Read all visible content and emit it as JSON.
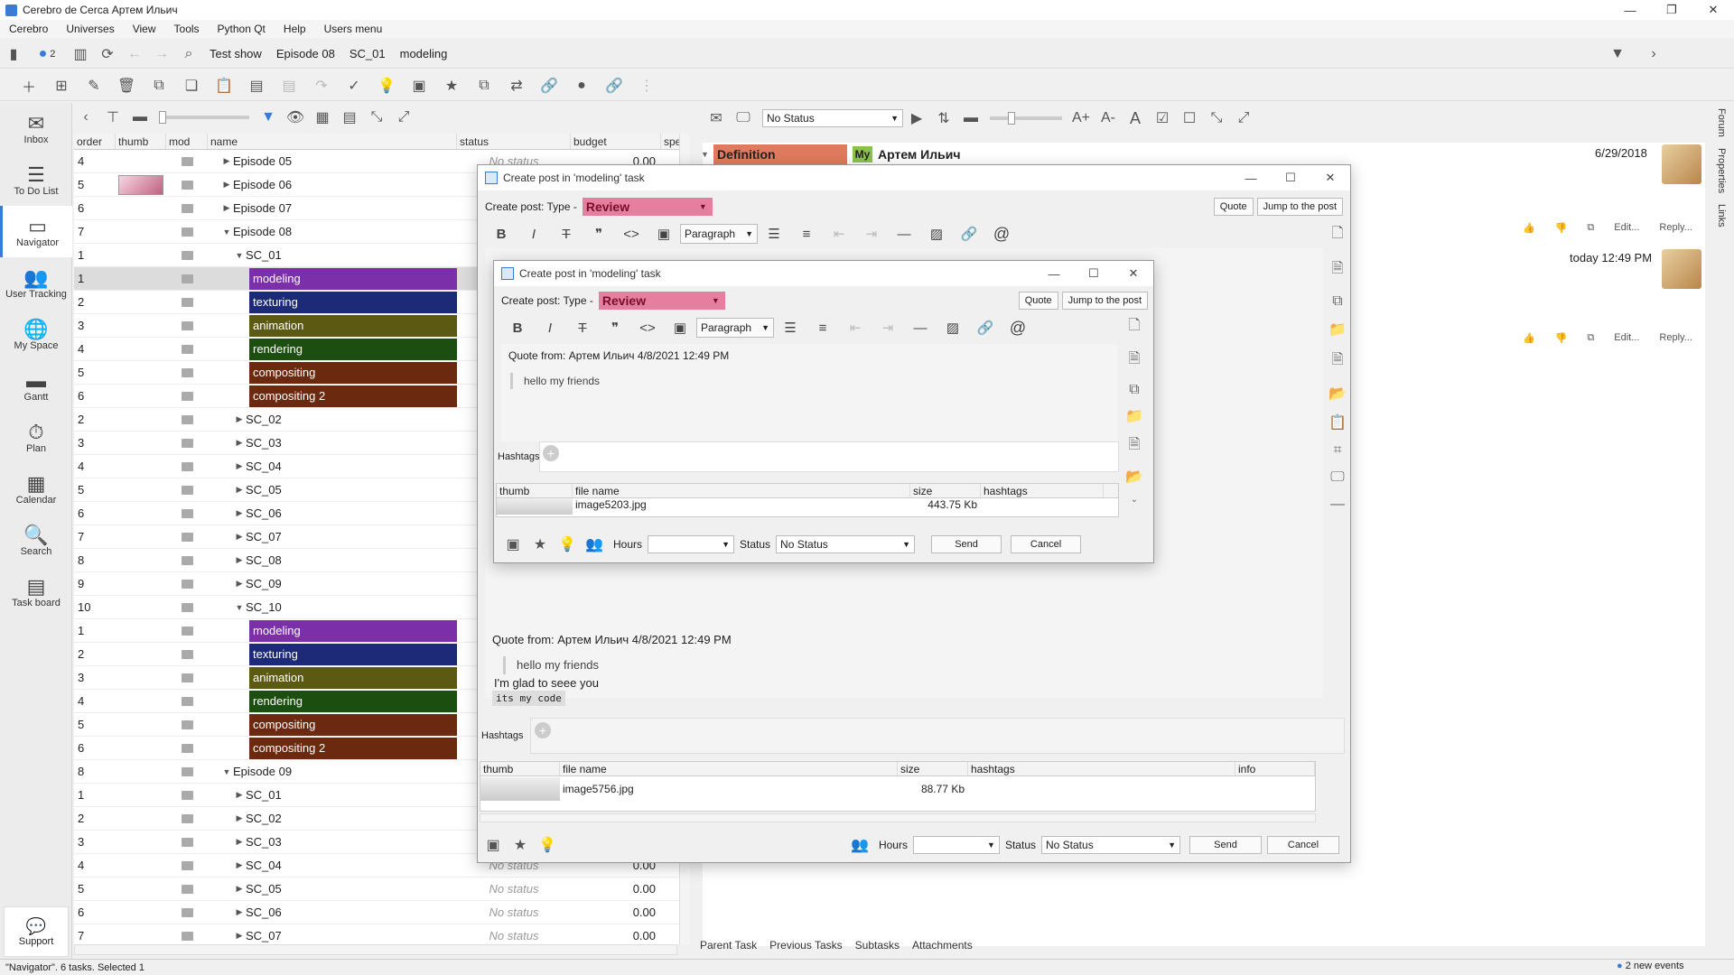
{
  "window": {
    "title": "Cerebro de Cerca  Артем Ильич"
  },
  "menu": [
    "Cerebro",
    "Universes",
    "View",
    "Tools",
    "Python Qt",
    "Help",
    "Users menu"
  ],
  "nav": {
    "badge": "2",
    "crumbs": [
      "Test show",
      "Episode 08",
      "SC_01",
      "modeling"
    ]
  },
  "sidebar": [
    {
      "label": "Inbox",
      "icon": "✉"
    },
    {
      "label": "To Do List",
      "icon": "☰"
    },
    {
      "label": "Navigator",
      "icon": "▭"
    },
    {
      "label": "User Tracking",
      "icon": "👥"
    },
    {
      "label": "My Space",
      "icon": "🌐"
    },
    {
      "label": "Gantt",
      "icon": "▬"
    },
    {
      "label": "Plan",
      "icon": "⏱"
    },
    {
      "label": "Calendar",
      "icon": "▦"
    },
    {
      "label": "Search",
      "icon": "🔍"
    },
    {
      "label": "Task board",
      "icon": "▤"
    }
  ],
  "support": "Support",
  "tree": {
    "columns": {
      "order": "order",
      "thumb": "thumb",
      "mod": "mod",
      "name": "name",
      "status": "status",
      "budget": "budget",
      "spe": "spe"
    },
    "rows": [
      {
        "order": "4",
        "name": "Episode 05",
        "lvl": 0,
        "exp": "closed",
        "status": "No status",
        "budget": "0.00"
      },
      {
        "order": "5",
        "name": "Episode 06",
        "lvl": 0,
        "exp": "closed",
        "thumb": true
      },
      {
        "order": "6",
        "name": "Episode 07",
        "lvl": 0,
        "exp": "closed"
      },
      {
        "order": "7",
        "name": "Episode 08",
        "lvl": 0,
        "exp": "open"
      },
      {
        "order": "1",
        "name": "SC_01",
        "lvl": 1,
        "exp": "open"
      },
      {
        "order": "1",
        "name": "modeling",
        "task": "#7b2fa8",
        "sel": true
      },
      {
        "order": "2",
        "name": "texturing",
        "task": "#1d2a78"
      },
      {
        "order": "3",
        "name": "animation",
        "task": "#5c5a12"
      },
      {
        "order": "4",
        "name": "rendering",
        "task": "#1c4e10"
      },
      {
        "order": "5",
        "name": "compositing",
        "task": "#6b2a10"
      },
      {
        "order": "6",
        "name": "compositing 2",
        "task": "#6b2a10"
      },
      {
        "order": "2",
        "name": "SC_02",
        "lvl": 1,
        "exp": "closed"
      },
      {
        "order": "3",
        "name": "SC_03",
        "lvl": 1,
        "exp": "closed"
      },
      {
        "order": "4",
        "name": "SC_04",
        "lvl": 1,
        "exp": "closed"
      },
      {
        "order": "5",
        "name": "SC_05",
        "lvl": 1,
        "exp": "closed"
      },
      {
        "order": "6",
        "name": "SC_06",
        "lvl": 1,
        "exp": "closed"
      },
      {
        "order": "7",
        "name": "SC_07",
        "lvl": 1,
        "exp": "closed"
      },
      {
        "order": "8",
        "name": "SC_08",
        "lvl": 1,
        "exp": "closed"
      },
      {
        "order": "9",
        "name": "SC_09",
        "lvl": 1,
        "exp": "closed"
      },
      {
        "order": "10",
        "name": "SC_10",
        "lvl": 1,
        "exp": "open"
      },
      {
        "order": "1",
        "name": "modeling",
        "task": "#7b2fa8"
      },
      {
        "order": "2",
        "name": "texturing",
        "task": "#1d2a78"
      },
      {
        "order": "3",
        "name": "animation",
        "task": "#5c5a12"
      },
      {
        "order": "4",
        "name": "rendering",
        "task": "#1c4e10"
      },
      {
        "order": "5",
        "name": "compositing",
        "task": "#6b2a10"
      },
      {
        "order": "6",
        "name": "compositing 2",
        "task": "#6b2a10"
      },
      {
        "order": "8",
        "name": "Episode 09",
        "lvl": 0,
        "exp": "open"
      },
      {
        "order": "1",
        "name": "SC_01",
        "lvl": 1,
        "exp": "closed"
      },
      {
        "order": "2",
        "name": "SC_02",
        "lvl": 1,
        "exp": "closed"
      },
      {
        "order": "3",
        "name": "SC_03",
        "lvl": 1,
        "exp": "closed"
      },
      {
        "order": "4",
        "name": "SC_04",
        "lvl": 1,
        "exp": "closed",
        "status": "No status",
        "budget": "0.00"
      },
      {
        "order": "5",
        "name": "SC_05",
        "lvl": 1,
        "exp": "closed",
        "status": "No status",
        "budget": "0.00"
      },
      {
        "order": "6",
        "name": "SC_06",
        "lvl": 1,
        "exp": "closed",
        "status": "No status",
        "budget": "0.00"
      },
      {
        "order": "7",
        "name": "SC_07",
        "lvl": 1,
        "exp": "closed",
        "status": "No status",
        "budget": "0.00"
      }
    ]
  },
  "rp": {
    "status_select": "No Status",
    "def_label": "Definition",
    "my": "My",
    "author": "Артем Ильич",
    "date1": "6/29/2018",
    "date2": "today 12:49 PM",
    "post_edit": "Edit...",
    "post_reply": "Reply...",
    "tabs": [
      "Parent Task",
      "Previous Tasks",
      "Subtasks",
      "Attachments"
    ],
    "vtabs": [
      "Forum",
      "Properties",
      "Links"
    ]
  },
  "status_text": "\"Navigator\". 6 tasks. Selected 1",
  "events": "2 new events",
  "outer": {
    "title": "Create post in 'modeling' task",
    "type_label": "Create post: Type -",
    "type": "Review",
    "quote_btn": "Quote",
    "jump_btn": "Jump to the post",
    "para": "Paragraph",
    "quote_from": "Quote from: Артем Ильич 4/8/2021 12:49 PM",
    "quote_text": "hello my friends",
    "code": "its my code",
    "body_text": "I'm glad  to seee you",
    "hashtags": "Hashtags",
    "fcols": {
      "thumb": "thumb",
      "file": "file name",
      "size": "size",
      "hashtags": "hashtags",
      "info": "info"
    },
    "file": {
      "name": "image5756.jpg",
      "size": "88.77 Kb"
    },
    "hours": "Hours",
    "status": "Status",
    "status_val": "No Status",
    "send": "Send",
    "cancel": "Cancel"
  },
  "inner": {
    "title": "Create post in 'modeling' task",
    "type_label": "Create post: Type -",
    "type": "Review",
    "quote_btn": "Quote",
    "jump_btn": "Jump to the post",
    "para": "Paragraph",
    "quote_from": "Quote from: Артем Ильич 4/8/2021 12:49 PM",
    "quote_text": "hello my friends",
    "hashtags": "Hashtags",
    "fcols": {
      "thumb": "thumb",
      "file": "file name",
      "size": "size",
      "hashtags": "hashtags"
    },
    "file": {
      "name": "image5203.jpg",
      "size": "443.75 Kb"
    },
    "hours": "Hours",
    "status": "Status",
    "status_val": "No Status",
    "send": "Send",
    "cancel": "Cancel"
  }
}
